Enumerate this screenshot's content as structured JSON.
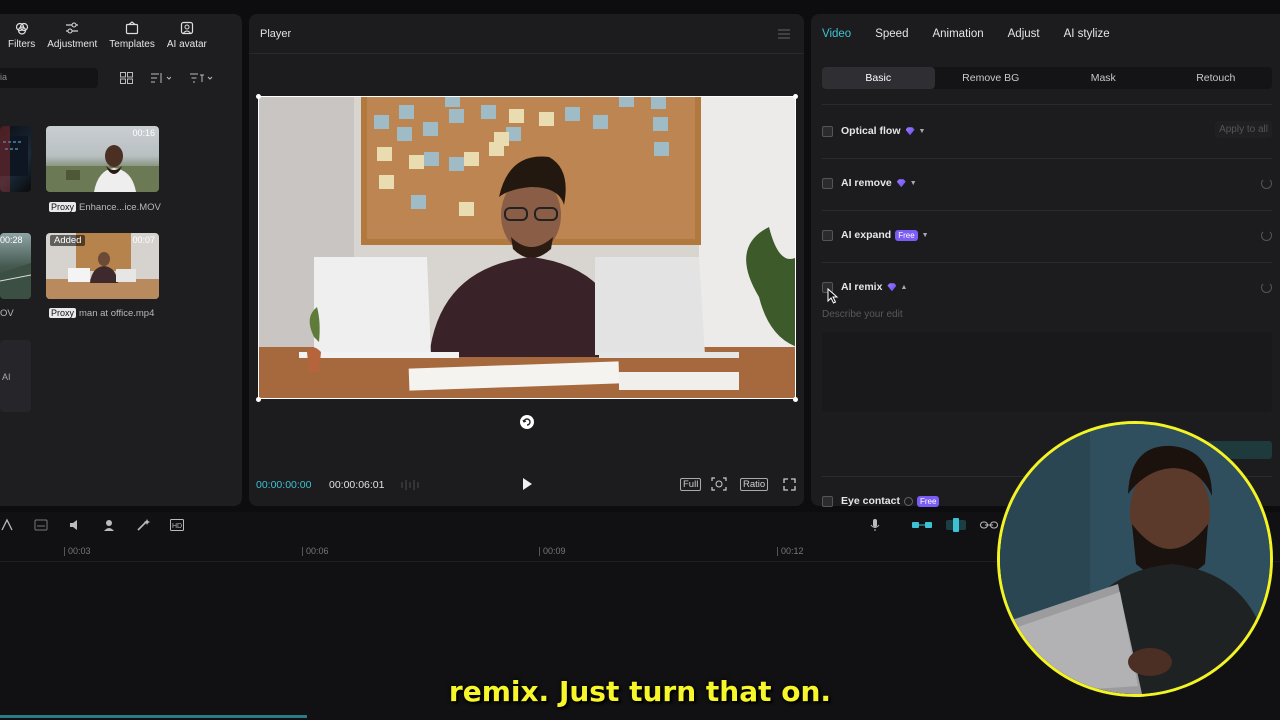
{
  "toolbar": {
    "items": [
      {
        "label": "Filters",
        "icon": "filters-icon"
      },
      {
        "label": "Adjustment",
        "icon": "adjustment-icon"
      },
      {
        "label": "Templates",
        "icon": "templates-icon"
      },
      {
        "label": "AI avatar",
        "icon": "ai-avatar-icon"
      }
    ]
  },
  "media": {
    "search_placeholder": "ia",
    "items": [
      {
        "label": "Enhance...ice.MOV",
        "duration": "00:16",
        "proxy": "Proxy"
      },
      {
        "label": "man at office.mp4",
        "duration": "00:07",
        "proxy": "Proxy",
        "badge": "Added"
      },
      {
        "label": "OV",
        "duration": "00:28"
      },
      {
        "label": "AI"
      }
    ]
  },
  "player": {
    "title": "Player",
    "time_current": "00:00:00:00",
    "time_total": "00:00:06:01",
    "controls": {
      "full": "Full",
      "ratio": "Ratio"
    }
  },
  "properties": {
    "tabs": [
      "Video",
      "Speed",
      "Animation",
      "Adjust",
      "AI stylize"
    ],
    "active_tab": "Video",
    "subtabs": [
      "Basic",
      "Remove BG",
      "Mask",
      "Retouch"
    ],
    "active_subtab": "Basic",
    "rows": {
      "optical_flow": "Optical flow",
      "apply_all": "Apply to all",
      "ai_remove": "AI remove",
      "ai_expand": "AI expand",
      "ai_remix": "AI remix",
      "eye_contact": "Eye contact",
      "free": "Free"
    },
    "remix_placeholder": "Describe your edit"
  },
  "timeline": {
    "ticks": [
      "00:03",
      "00:06",
      "00:09",
      "00:12"
    ]
  },
  "caption": "remix. Just turn that on.",
  "colors": {
    "accent": "#3ec1d3",
    "caption": "#f6f62a",
    "cam_ring": "#f4f423",
    "badge": "#7b5cf5"
  }
}
